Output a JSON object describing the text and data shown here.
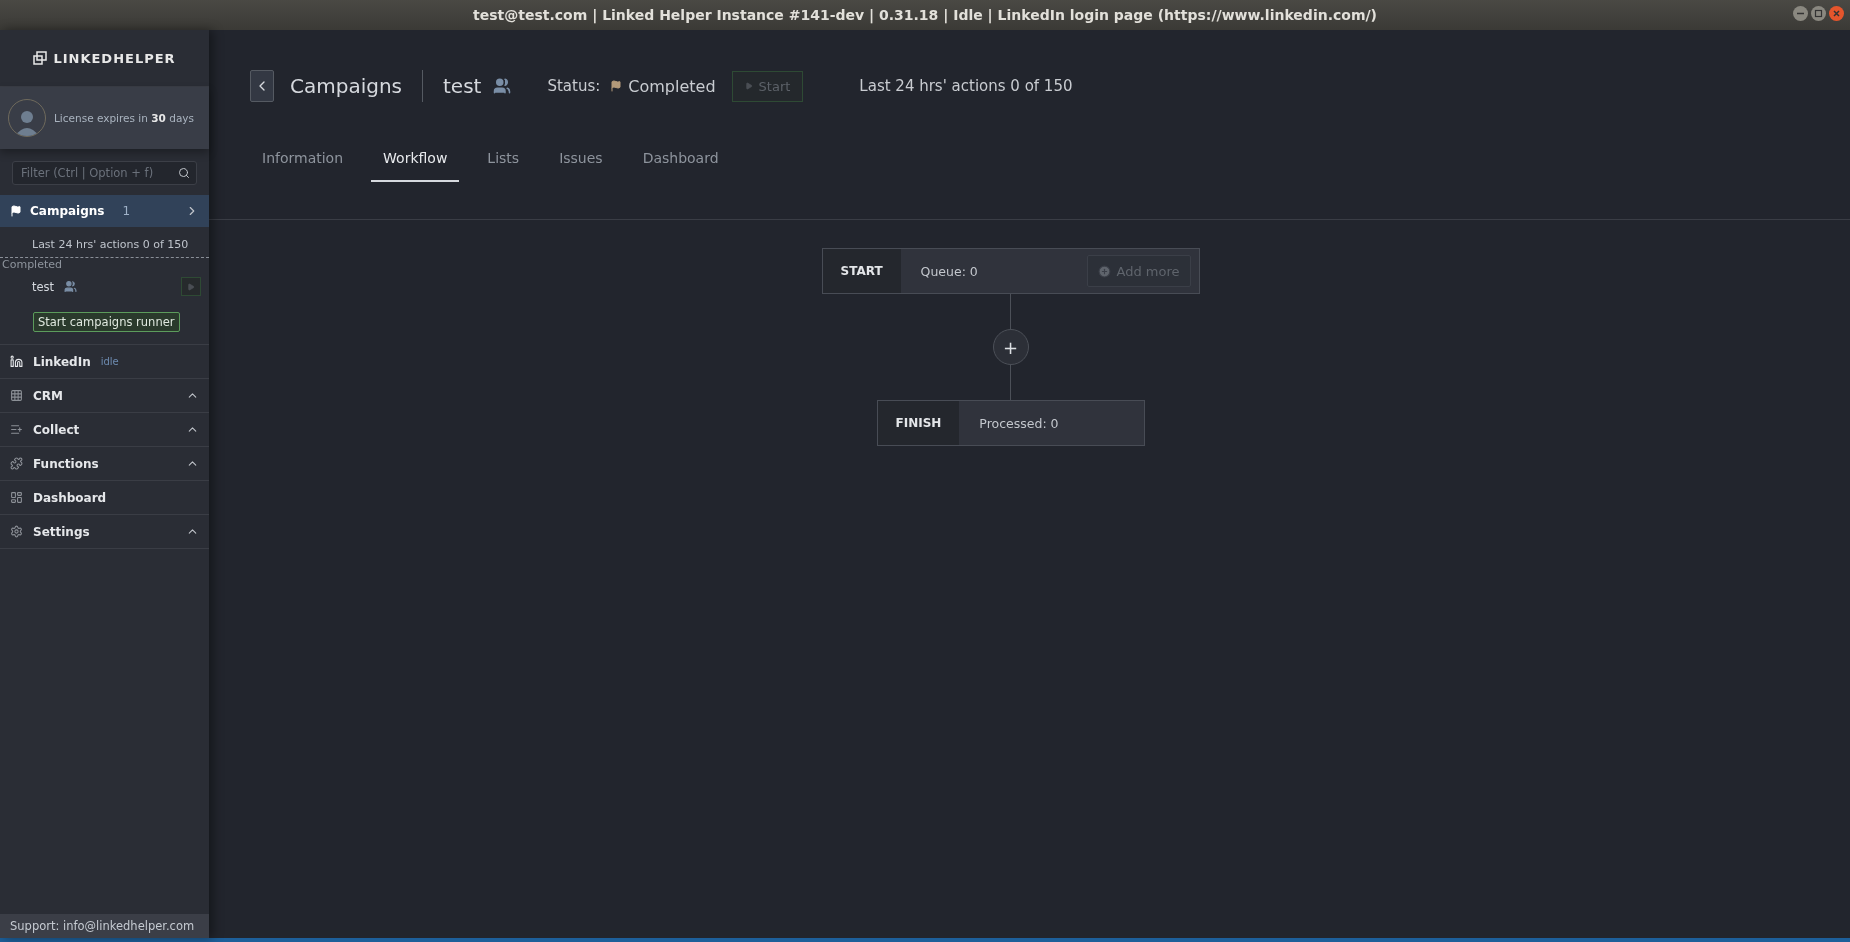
{
  "window": {
    "title": "test@test.com | Linked Helper Instance #141-dev | 0.31.18 | Idle | LinkedIn login page (https://www.linkedin.com/)"
  },
  "sidebar": {
    "logo": "LINKEDHELPER",
    "license": "License expires in **30** days",
    "filter": {
      "placeholder": "Filter (Ctrl | Option + f)"
    },
    "campaigns": {
      "label": "Campaigns",
      "count": "1",
      "selected": true,
      "actions": "Last 24 hrs' actions 0 of 150",
      "group": "Completed",
      "items": [
        {
          "name": "test"
        }
      ],
      "runner_button": "Start campaigns runner"
    },
    "items": [
      {
        "kind": "linkedin",
        "label": "LinkedIn",
        "status": "idle"
      },
      {
        "kind": "crm",
        "label": "CRM",
        "expanded": false
      },
      {
        "kind": "collect",
        "label": "Collect",
        "expanded": false
      },
      {
        "kind": "functions",
        "label": "Functions",
        "expanded": false
      },
      {
        "kind": "dashboard",
        "label": "Dashboard"
      },
      {
        "kind": "settings",
        "label": "Settings",
        "expanded": false
      }
    ],
    "support": "Support: info@linkedhelper.com"
  },
  "header": {
    "breadcrumb": "Campaigns",
    "campaign": "test",
    "status_label": "Status:",
    "status": "Completed",
    "start_button": "Start",
    "actions": "Last 24 hrs' actions 0 of 150"
  },
  "tabs": [
    {
      "label": "Information",
      "selected": false
    },
    {
      "label": "Workflow",
      "selected": true
    },
    {
      "label": "Lists",
      "selected": false
    },
    {
      "label": "Issues",
      "selected": false
    },
    {
      "label": "Dashboard",
      "selected": false
    }
  ],
  "workflow": {
    "start": {
      "label": "START",
      "info": "Queue: 0",
      "button": "Add more"
    },
    "add": "+",
    "finish": {
      "label": "FINISH",
      "info": "Processed: 0"
    }
  }
}
